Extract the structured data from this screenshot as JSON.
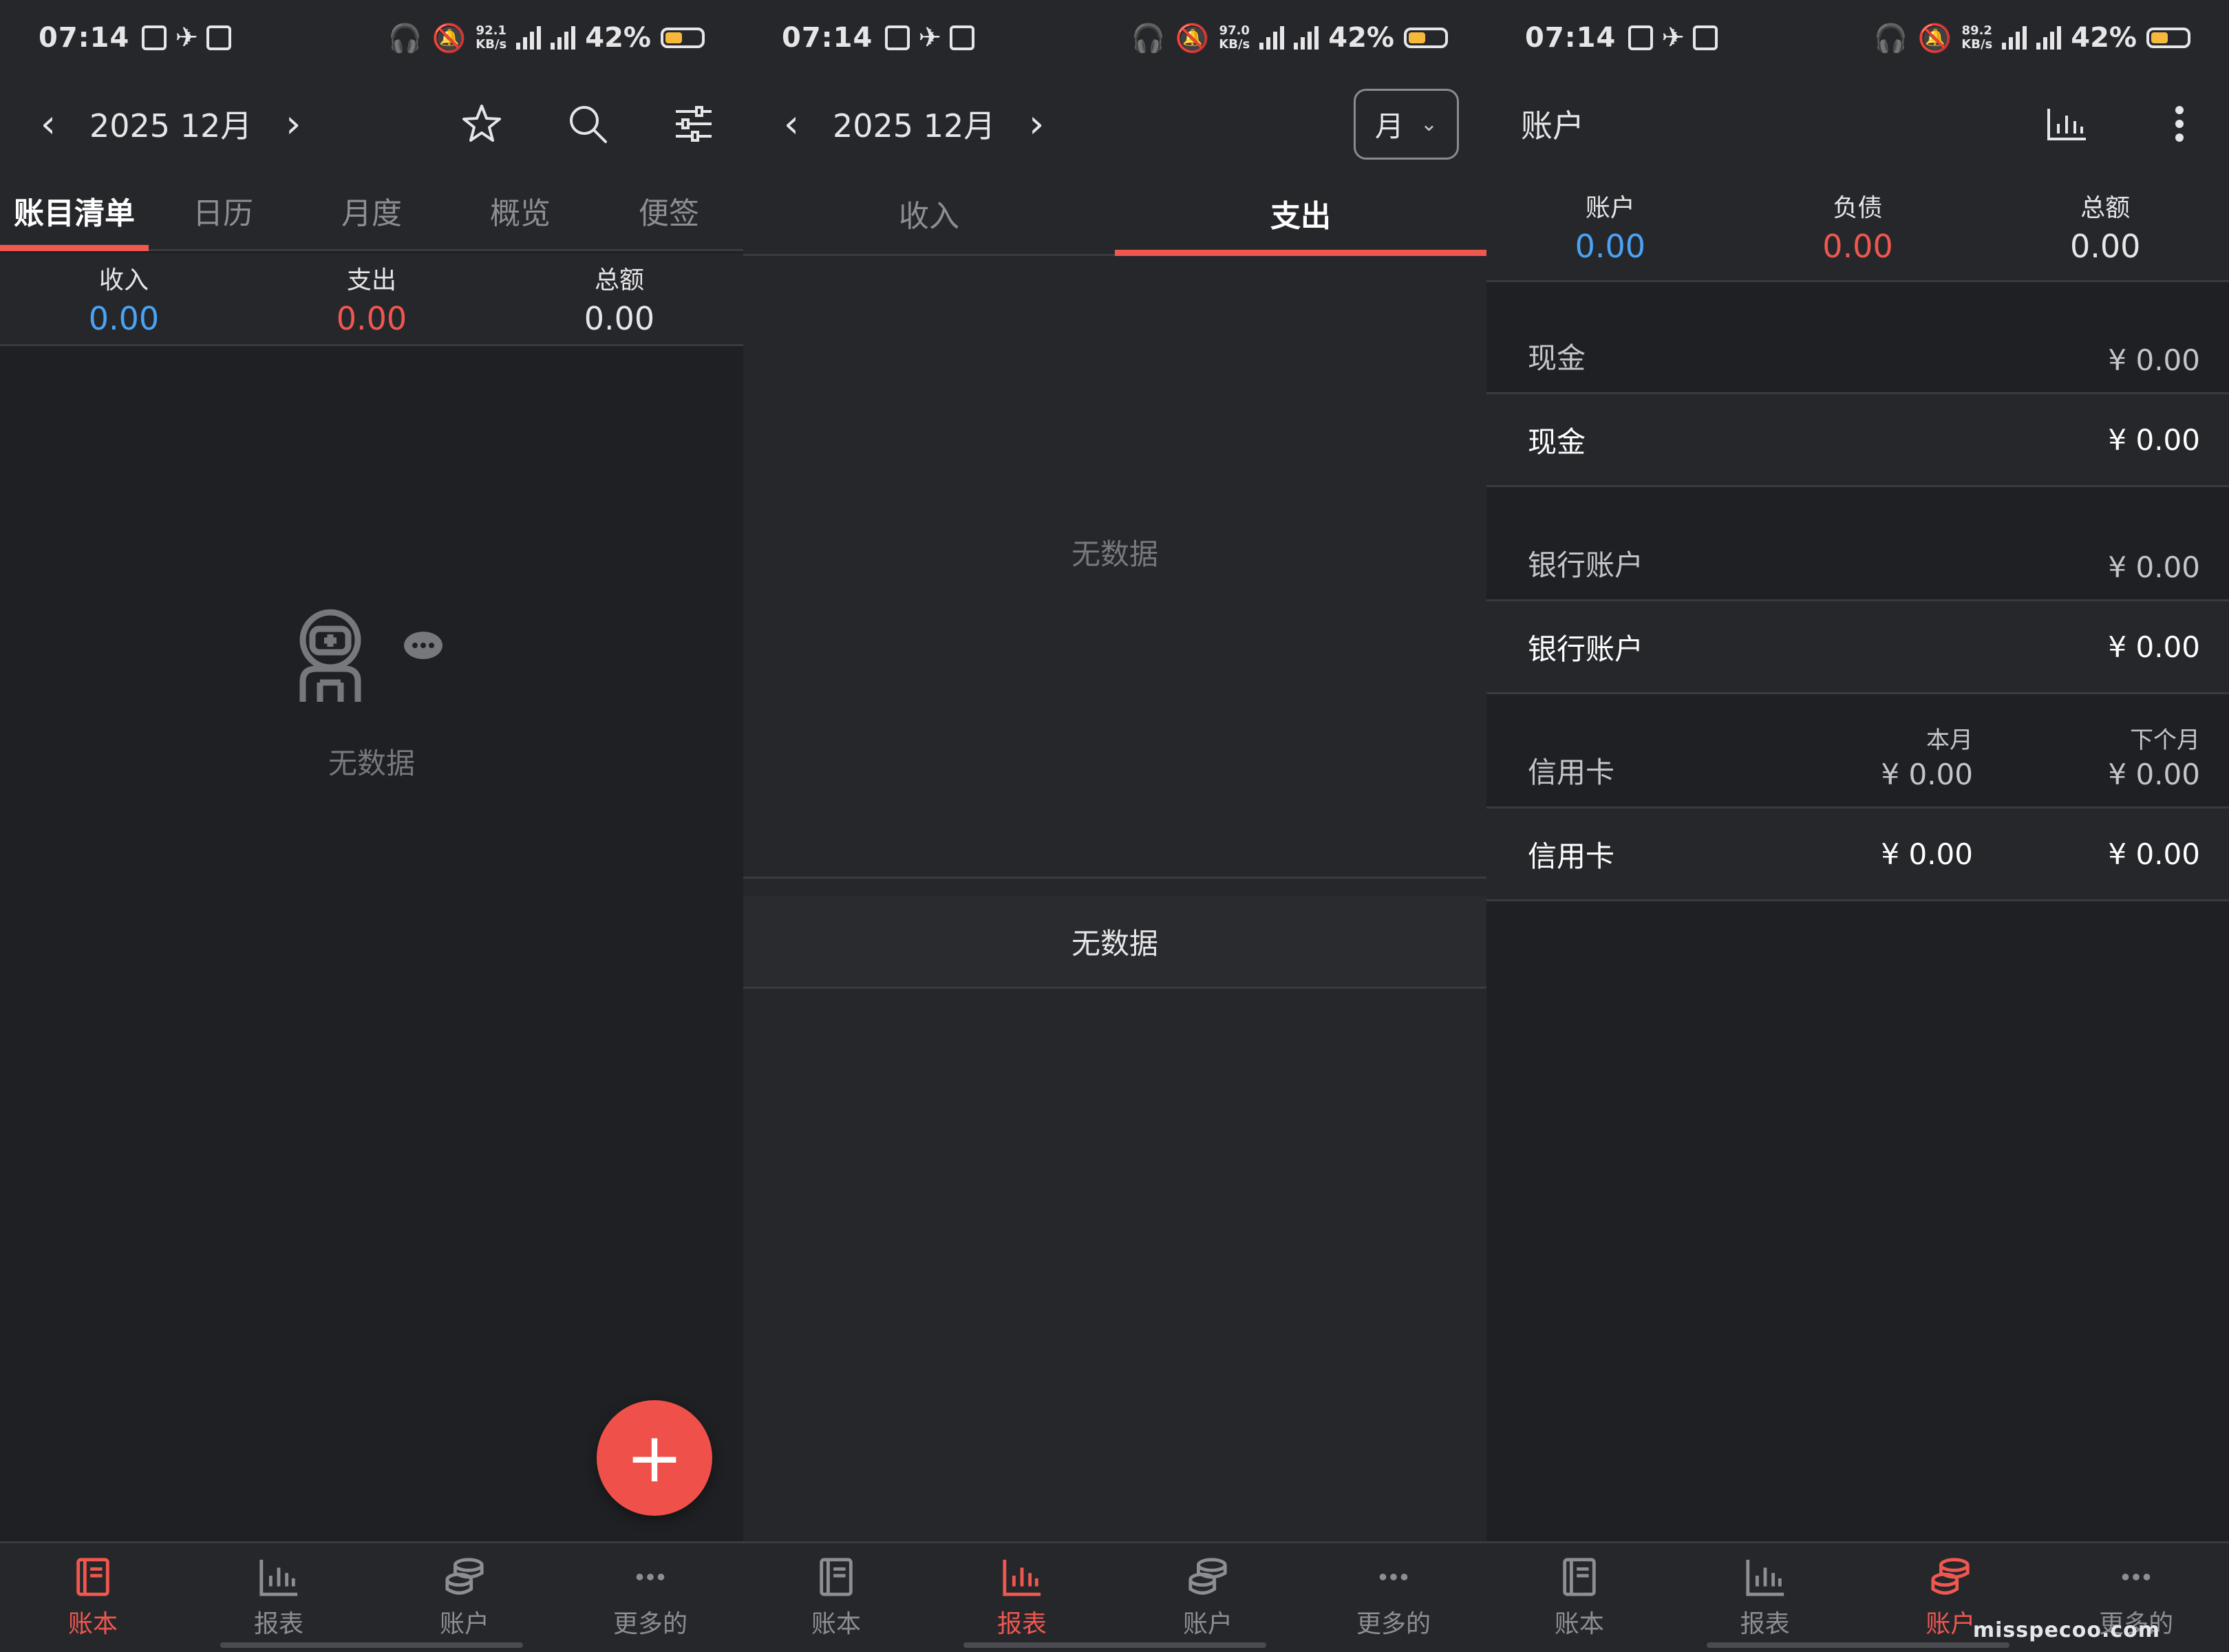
{
  "status": {
    "time": "07:14",
    "battery": "42%",
    "net_speed_1": "92.1",
    "net_speed_2": "97.0",
    "net_speed_3": "89.2",
    "net_unit": "KB/s"
  },
  "panel1": {
    "month": "2025 12月",
    "tabs": [
      "账目清单",
      "日历",
      "月度",
      "概览",
      "便签"
    ],
    "summary": [
      {
        "label": "收入",
        "value": "0.00"
      },
      {
        "label": "支出",
        "value": "0.00"
      },
      {
        "label": "总额",
        "value": "0.00"
      }
    ],
    "empty_text": "无数据",
    "fab": "+"
  },
  "panel2": {
    "month": "2025 12月",
    "period": "月",
    "tabs": [
      "收入",
      "支出"
    ],
    "chart_empty": "无数据",
    "list_empty": "无数据"
  },
  "panel3": {
    "title": "账户",
    "summary": [
      {
        "label": "账户",
        "value": "0.00"
      },
      {
        "label": "负债",
        "value": "0.00"
      },
      {
        "label": "总额",
        "value": "0.00"
      }
    ],
    "groups": [
      {
        "head": "现金",
        "head_amount": "¥ 0.00",
        "row": "现金",
        "row_amount": "¥ 0.00"
      },
      {
        "head": "银行账户",
        "head_amount": "¥ 0.00",
        "row": "银行账户",
        "row_amount": "¥ 0.00"
      }
    ],
    "credit": {
      "head": "信用卡",
      "col1_label": "本月",
      "col2_label": "下个月",
      "head_col1": "¥ 0.00",
      "head_col2": "¥ 0.00",
      "row": "信用卡",
      "row_col1": "¥ 0.00",
      "row_col2": "¥ 0.00"
    }
  },
  "bottomnav": [
    "账本",
    "报表",
    "账户",
    "更多的"
  ],
  "watermark": "misspecoo.com",
  "colors": {
    "accent": "#f0574f",
    "income": "#4aa3f5",
    "background": "#1f2023"
  }
}
